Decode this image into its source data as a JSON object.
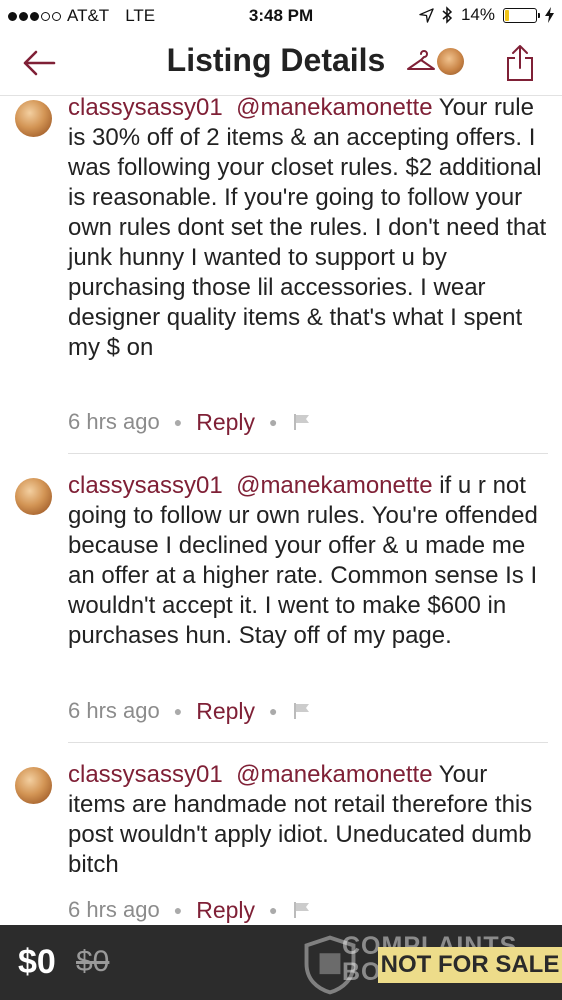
{
  "status_bar": {
    "carrier": "AT&T",
    "network": "LTE",
    "time": "3:48 PM",
    "battery": "14%",
    "battery_level": 0.14,
    "signal_bars": 3
  },
  "nav": {
    "title": "Listing Details"
  },
  "comments": [
    {
      "user": "classysassy01",
      "mention": "@manekamonette",
      "body": "Your rule is 30% off of 2 items & an accepting offers. I was following your closet rules. $2 additional is reasonable. If you're going to follow your own rules dont set the rules. I don't need that junk hunny I wanted to support u by purchasing those lil accessories. I wear designer quality items & that's what I spent my $ on",
      "time": "6 hrs ago",
      "reply_label": "Reply"
    },
    {
      "user": "classysassy01",
      "mention": "@manekamonette",
      "body": "if u r not going to follow ur own rules. You're offended because I declined your offer & u made me an offer at a higher rate. Common sense Is I wouldn't accept it. I went to make $600 in purchases hun. Stay off of my page.",
      "time": "6 hrs ago",
      "reply_label": "Reply"
    },
    {
      "user": "classysassy01",
      "mention": "@manekamonette",
      "body": "Your items are handmade not retail therefore this post wouldn't apply idiot. Uneducated dumb bitch",
      "time": "6 hrs ago",
      "reply_label": "Reply"
    }
  ],
  "bottom_bar": {
    "price": "$0",
    "original_price": "$0",
    "watermark": "COMPLAINTS BOARD",
    "badge": "NOT FOR SALE"
  },
  "colors": {
    "accent": "#7f2036",
    "bottom_bar": "#2c2c2c",
    "badge": "#eddc8a"
  }
}
